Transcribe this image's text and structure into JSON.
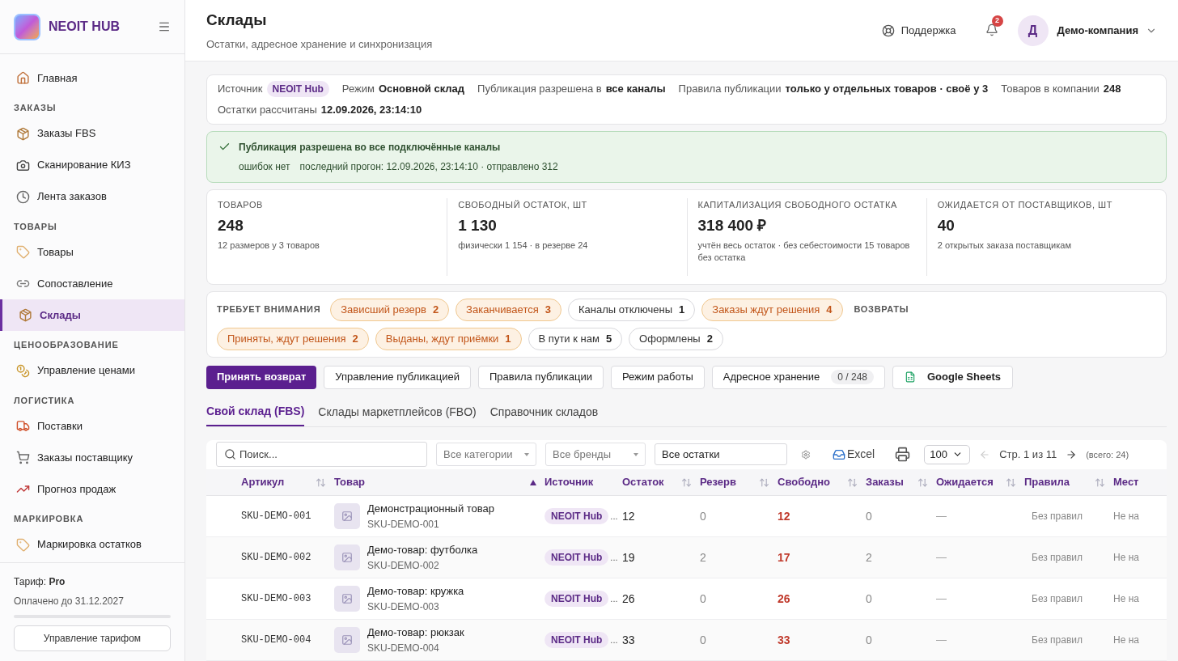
{
  "sidebar": {
    "brand": "NEOIT HUB",
    "sections": [
      {
        "items": [
          {
            "label": "Главная",
            "selected": false
          }
        ]
      },
      {
        "title": "ЗАКАЗЫ",
        "items": [
          {
            "label": "Заказы FBS",
            "selected": false
          },
          {
            "label": "Сканирование КИЗ",
            "selected": false
          },
          {
            "label": "Лента заказов",
            "selected": false
          }
        ]
      },
      {
        "title": "ТОВАРЫ",
        "items": [
          {
            "label": "Товары",
            "selected": false
          },
          {
            "label": "Сопоставление",
            "selected": false
          },
          {
            "label": "Склады",
            "selected": true
          }
        ]
      },
      {
        "title": "ЦЕНООБРАЗОВАНИЕ",
        "items": [
          {
            "label": "Управление ценами",
            "selected": false
          }
        ]
      },
      {
        "title": "ЛОГИСТИКА",
        "items": [
          {
            "label": "Поставки",
            "selected": false
          },
          {
            "label": "Заказы поставщику",
            "selected": false
          },
          {
            "label": "Прогноз продаж",
            "selected": false
          }
        ]
      },
      {
        "title": "МАРКИРОВКА",
        "items": [
          {
            "label": "Маркировка остатков",
            "selected": false
          }
        ]
      }
    ],
    "plan": {
      "label": "Тариф:",
      "name": "Pro",
      "paid": "Оплачено до 31.12.2027",
      "button": "Управление тарифом"
    }
  },
  "header": {
    "title": "Склады",
    "subtitle": "Остатки, адресное хранение и синхронизация",
    "support": "Поддержка",
    "notifications": "2",
    "avatar": "Д",
    "company": "Демо-компания"
  },
  "info": [
    {
      "label": "Источник",
      "value": "NEOIT Hub",
      "kind": "badge"
    },
    {
      "label": "Режим",
      "value": "Основной склад",
      "kind": "text"
    },
    {
      "label": "Публикация разрешена в",
      "value": "все каналы",
      "kind": "text"
    },
    {
      "label": "Правила публикации",
      "value": "только у отдельных товаров · своё у 3",
      "kind": "text"
    },
    {
      "label": "Товаров в компании",
      "value": "248",
      "kind": "text"
    },
    {
      "label": "Остатки рассчитаны",
      "value": "12.09.2026, 23:14:10",
      "kind": "text"
    }
  ],
  "alert": {
    "title": "Публикация разрешена во все подключённые каналы",
    "errors": "ошибок нет",
    "details": "последний прогон: 12.09.2026, 23:14:10 · отправлено 312"
  },
  "stats": [
    {
      "label": "ТОВАРОВ",
      "value": "248",
      "note": "12 размеров у 3 товаров"
    },
    {
      "label": "СВОБОДНЫЙ ОСТАТОК, ШТ",
      "value": "1 130",
      "note": "физически 1 154 · в резерве 24"
    },
    {
      "label": "КАПИТАЛИЗАЦИЯ СВОБОДНОГО ОСТАТКА",
      "value": "318 400 ₽",
      "note": "учтён весь остаток · без себестоимости 15 товаров без остатка"
    },
    {
      "label": "ОЖИДАЕТСЯ ОТ ПОСТАВЩИКОВ, ШТ",
      "value": "40",
      "note": "2 открытых заказа поставщикам"
    }
  ],
  "attention": {
    "title": "ТРЕБУЕТ ВНИМАНИЯ",
    "returns_title": "ВОЗВРАТЫ",
    "chips": [
      {
        "label": "Зависший резерв",
        "count": "2",
        "warning": true
      },
      {
        "label": "Заканчивается",
        "count": "3",
        "warning": true
      },
      {
        "label": "Каналы отключены",
        "count": "1",
        "warning": false
      },
      {
        "label": "Заказы ждут решения",
        "count": "4",
        "warning": true
      }
    ],
    "returns": [
      {
        "label": "Приняты, ждут решения",
        "count": "2",
        "warning": true
      },
      {
        "label": "Выданы, ждут приёмки",
        "count": "1",
        "warning": true
      },
      {
        "label": "В пути к нам",
        "count": "5",
        "warning": false
      },
      {
        "label": "Оформлены",
        "count": "2",
        "warning": false
      }
    ]
  },
  "actions": [
    {
      "label": "Принять возврат",
      "kind": "primary"
    },
    {
      "label": "Управление публикацией",
      "kind": "plain"
    },
    {
      "label": "Правила публикации",
      "kind": "plain"
    },
    {
      "label": "Режим работы",
      "kind": "plain"
    },
    {
      "label": "Адресное хранение",
      "kind": "counter",
      "counter": "0 / 248"
    },
    {
      "label": "Google Sheets",
      "kind": "sheets"
    }
  ],
  "tabs": [
    {
      "label": "Свой склад (FBS)",
      "selected": true
    },
    {
      "label": "Склады маркетплейсов (FBO)",
      "selected": false
    },
    {
      "label": "Справочник складов",
      "selected": false
    }
  ],
  "toolbar": {
    "search": {
      "placeholder": "Поиск..."
    },
    "category": "Все категории",
    "brand": "Все бренды",
    "stock": "Все остатки",
    "excel": "Excel",
    "page_size": "100",
    "page": "Стр. 1 из 11",
    "total": "(всего: 24)"
  },
  "table": {
    "columns": [
      {
        "label": "Артикул",
        "kind": "sortable"
      },
      {
        "label": "Товар",
        "kind": "sorted"
      },
      {
        "label": "Источник",
        "kind": "plain"
      },
      {
        "label": "Остаток",
        "kind": "sortable"
      },
      {
        "label": "Резерв",
        "kind": "sortable"
      },
      {
        "label": "Свободно",
        "kind": "sortable"
      },
      {
        "label": "Заказы",
        "kind": "sortable"
      },
      {
        "label": "Ожидается",
        "kind": "sortable"
      },
      {
        "label": "Правила",
        "kind": "sortable"
      },
      {
        "label": "Мест",
        "kind": "plain"
      }
    ],
    "rows": [
      {
        "sku": "SKU-DEMO-001",
        "name": "Демонстрационный товар",
        "code": "SKU-DEMO-001",
        "source": "NEOIT Hub",
        "more": "...",
        "stock": "12",
        "reserve": "0",
        "free": "12",
        "orders": "0",
        "expected": "—",
        "rules": "Без правил",
        "place": "Не на"
      },
      {
        "sku": "SKU-DEMO-002",
        "name": "Демо-товар: футболка",
        "code": "SKU-DEMO-002",
        "source": "NEOIT Hub",
        "more": "...",
        "stock": "19",
        "reserve": "2",
        "free": "17",
        "orders": "2",
        "expected": "—",
        "rules": "Без правил",
        "place": "Не на"
      },
      {
        "sku": "SKU-DEMO-003",
        "name": "Демо-товар: кружка",
        "code": "SKU-DEMO-003",
        "source": "NEOIT Hub",
        "more": "...",
        "stock": "26",
        "reserve": "0",
        "free": "26",
        "orders": "0",
        "expected": "—",
        "rules": "Без правил",
        "place": "Не на"
      },
      {
        "sku": "SKU-DEMO-004",
        "name": "Демо-товар: рюкзак",
        "code": "SKU-DEMO-004",
        "source": "NEOIT Hub",
        "more": "...",
        "stock": "33",
        "reserve": "0",
        "free": "33",
        "orders": "0",
        "expected": "—",
        "rules": "Без правил",
        "place": "Не на"
      }
    ]
  }
}
